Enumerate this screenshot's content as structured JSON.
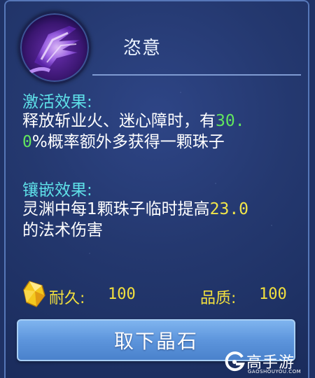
{
  "skill": {
    "title": "恣意",
    "icon": "purple-energy-hand-icon"
  },
  "activation": {
    "heading": "激活效果:",
    "line1_prefix": "释放斩业火、迷心障时，有",
    "line1_highlight": "30.",
    "line2_highlight": "0",
    "line2_rest": "%概率额外多获得一颗珠子"
  },
  "inlay": {
    "heading": "镶嵌效果:",
    "line1_prefix": "灵渊中每1颗珠子临时提高",
    "line1_highlight": "23.0",
    "line2": "的法术伤害"
  },
  "stats": {
    "durability_label": "耐久:",
    "durability_value": "100",
    "quality_label": "品质:",
    "quality_value": "100",
    "icon": "yellow-crystal-icon"
  },
  "action": {
    "remove_label": "取下晶石"
  },
  "watermark": {
    "brand": "高手游",
    "domain": "GAOSHOUYOU.COM"
  },
  "colors": {
    "heading": "#5ee0e8",
    "highlight_green": "#62e65e",
    "highlight_yellow": "#f2e64a",
    "stat_text": "#f2e03e",
    "button": "#5d95dc"
  }
}
